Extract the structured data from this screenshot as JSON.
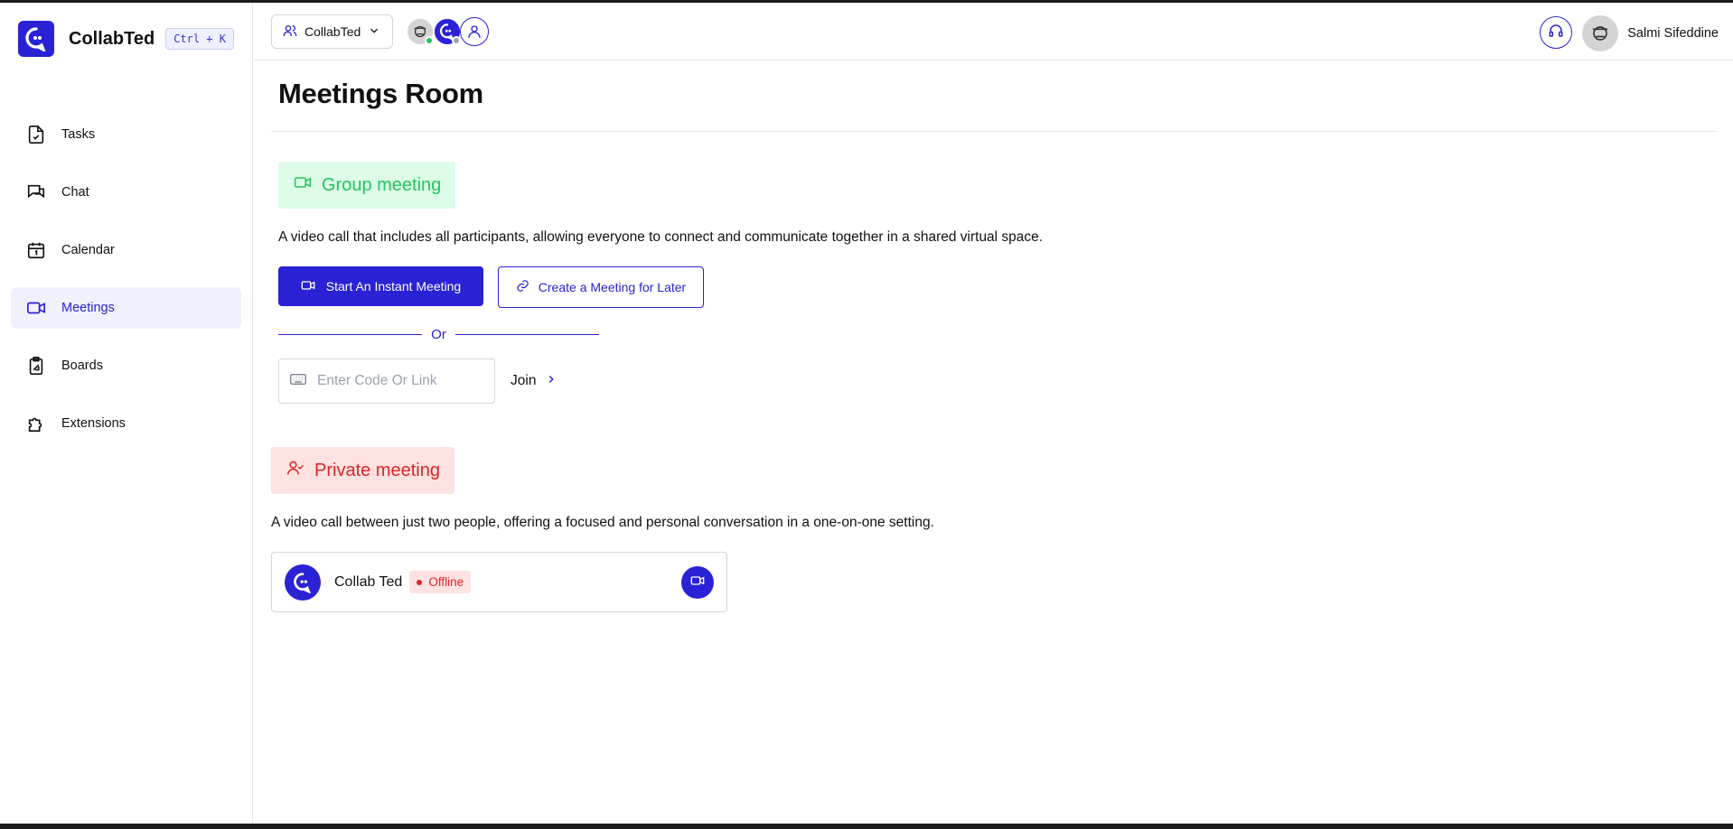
{
  "brand": {
    "name": "CollabTed",
    "shortcut": "Ctrl + K"
  },
  "sidebar": {
    "items": [
      {
        "label": "Tasks",
        "icon": "tasks-icon"
      },
      {
        "label": "Chat",
        "icon": "chat-icon"
      },
      {
        "label": "Calendar",
        "icon": "calendar-icon"
      },
      {
        "label": "Meetings",
        "icon": "video-icon",
        "active": true
      },
      {
        "label": "Boards",
        "icon": "boards-icon"
      },
      {
        "label": "Extensions",
        "icon": "puzzle-icon"
      }
    ]
  },
  "topbar": {
    "workspace": "CollabTed",
    "user_name": "Salmi Sifeddine"
  },
  "main": {
    "title": "Meetings Room",
    "group": {
      "label": "Group meeting",
      "description": "A video call that includes all participants, allowing everyone to connect and communicate together in a shared virtual space.",
      "instant_label": "Start An Instant Meeting",
      "later_label": "Create a Meeting for Later",
      "or_label": "Or",
      "code_placeholder": "Enter Code Or Link",
      "join_label": "Join"
    },
    "private": {
      "label": "Private meeting",
      "description": "A video call between just two people, offering a focused and personal conversation in a one-on-one setting.",
      "contact_name": "Collab Ted",
      "contact_status": "Offline"
    }
  },
  "colors": {
    "accent": "#2a22d4",
    "green": "#22c55e",
    "red": "#dc2626"
  }
}
